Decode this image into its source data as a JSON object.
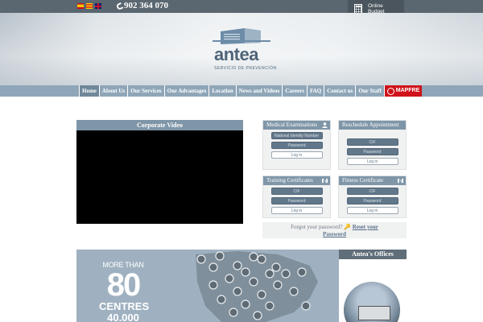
{
  "topbar": {
    "languages": [
      "es",
      "ca",
      "en"
    ],
    "phone": "902 364 070"
  },
  "budget": {
    "line1": "Online",
    "line2": "Budget"
  },
  "logo": {
    "name": "antea",
    "subtitle": "SERVICIO DE PREVENCIÓN"
  },
  "nav": {
    "items": [
      "Home",
      "About Us",
      "Our Services",
      "Our Advantages",
      "Location",
      "News and Videos",
      "Careers",
      "FAQ",
      "Contact us",
      "Our Staff"
    ],
    "mapfre": "MAPFRE"
  },
  "video": {
    "title": "Corporate Video"
  },
  "boxes": {
    "medical": {
      "title": "Medical Examinations",
      "f1": "National Identity Number",
      "f2": "Password",
      "btn": "Log in"
    },
    "reschedule": {
      "title": "Reschedule Appointment",
      "f1": "CIF",
      "f2": "Password",
      "btn": "Log in"
    },
    "training": {
      "title": "Training Certificates",
      "f1": "CIF",
      "f2": "Password",
      "btn": "Log in"
    },
    "fitness": {
      "title": "Fitness Certificate",
      "f1": "CIF",
      "f2": "Password",
      "btn": "Log in"
    }
  },
  "forgot": {
    "text": "Forgot your password?",
    "link1": "Reset your",
    "link2": "Password"
  },
  "map": {
    "more": "MORE THAN",
    "num": "80",
    "centres": "CENTRES",
    "num2": "40.000"
  },
  "offices": {
    "title": "Antea's Offices"
  }
}
